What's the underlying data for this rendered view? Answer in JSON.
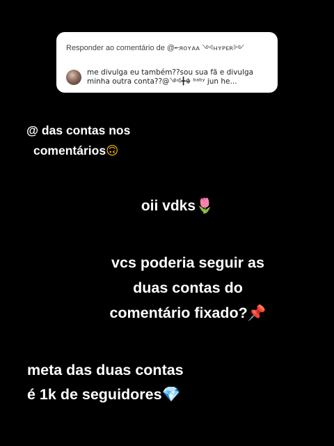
{
  "reply_card": {
    "header_prefix": "Responder ao comentário de @",
    "header_handle": "╾ᴙᴏʏᴀᴀ ༺ʜʏᴘᴇʀ༻",
    "comment_text": "me divulga eu também??sou sua fã  e divulga minha outra conta??@༺╋☬ ᵇᵃᵇʸ jun he..."
  },
  "captions": {
    "tag_line1": "@ das contas nos",
    "tag_line2": "comentários",
    "tag_emoji": "🙃",
    "greeting": "oii vdks",
    "greeting_emoji": "🌷",
    "request_line1": "vcs poderia seguir as",
    "request_line2": "duas contas do",
    "request_line3": "comentário fixado?",
    "request_emoji": "📌",
    "goal_line1": "meta das duas contas",
    "goal_line2": "é 1k de seguidores",
    "goal_emoji": "💎"
  }
}
